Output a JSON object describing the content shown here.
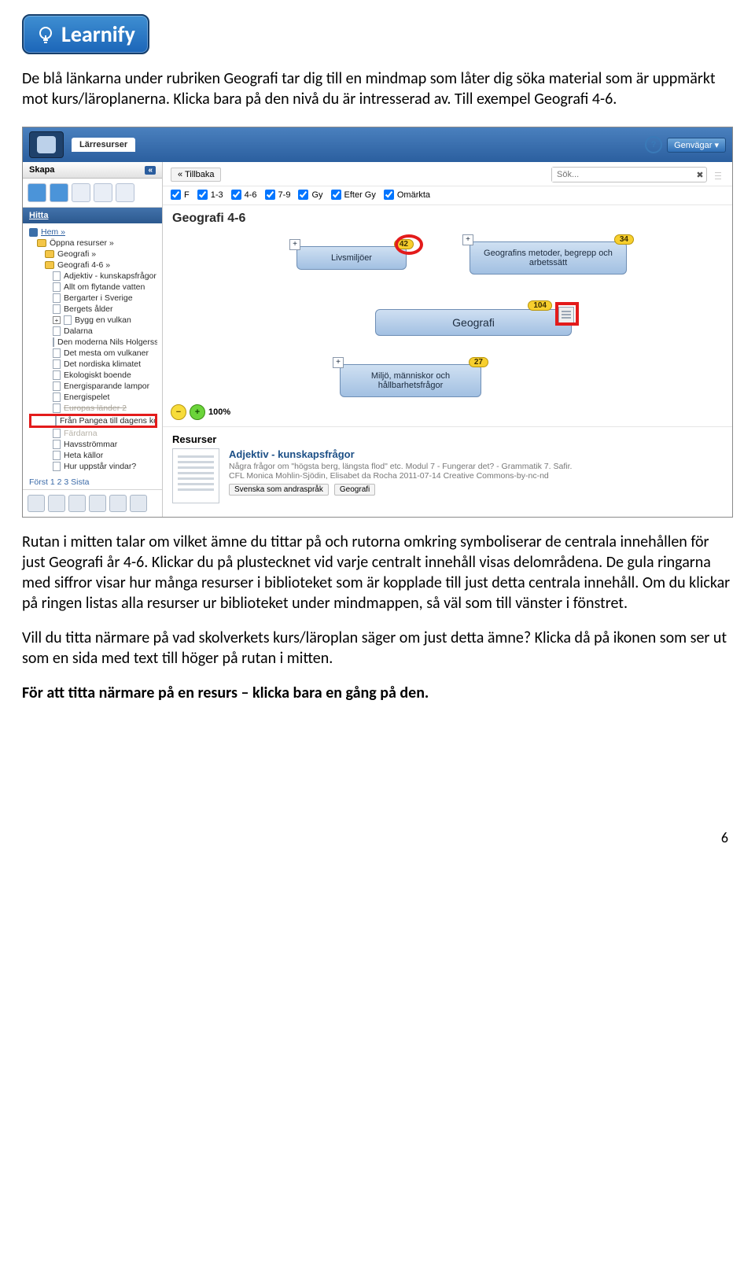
{
  "logo_text": "Learnify",
  "paragraph_1": "De blå länkarna under rubriken Geografi tar dig till en mindmap som låter dig söka material som är uppmärkt mot kurs/läroplanerna. Klicka bara på den nivå du är intresserad av. Till exempel Geografi 4-6.",
  "paragraph_2": "Rutan i mitten talar om vilket ämne du tittar på och rutorna omkring symboliserar de centrala innehållen för just Geografi år 4-6. Klickar du på plustecknet vid varje centralt innehåll visas delområdena. De gula ringarna med siffror visar hur många resurser i biblioteket som är kopplade till just detta centrala innehåll. Om du klickar på ringen listas alla resurser ur biblioteket under mindmappen, så väl som till vänster i fönstret.",
  "paragraph_3": "Vill du titta närmare på vad skolverkets kurs/läroplan säger om just detta ämne? Klicka då på ikonen som ser ut som en sida med text till höger på rutan i mitten.",
  "paragraph_4": "För att titta närmare på en resurs – klicka bara en gång på den.",
  "page_number": "6",
  "screenshot": {
    "title_tab": "Lärresurser",
    "shortcuts_btn": "Genvägar ▾",
    "sidebar": {
      "skapa": "Skapa",
      "hitta": "Hitta",
      "hem": "Hem »",
      "item_open": "Öppna resurser »",
      "item_geo": "Geografi »",
      "item_geo46": "Geografi 4-6 »",
      "items": [
        "Adjektiv - kunskapsfrågor",
        "Allt om flytande vatten",
        "Bergarter i Sverige",
        "Bergets ålder",
        "Bygg en vulkan",
        "Dalarna",
        "Den moderna Nils Holgerss",
        "Det mesta om vulkaner",
        "Det nordiska klimatet",
        "Ekologiskt boende",
        "Energisparande lampor",
        "Energispelet",
        "Europas länder 2"
      ],
      "highlight_item": "Från Pangea till dagens kon",
      "items_after": [
        "Färdarna",
        "Havsströmmar",
        "Heta källor",
        "Hur uppstår vindar?"
      ],
      "pager": "Först 1 2 3 Sista"
    },
    "main": {
      "back": "« Tillbaka",
      "search_placeholder": "Sök...",
      "filters": [
        "F",
        "1-3",
        "4-6",
        "7-9",
        "Gy",
        "Efter Gy",
        "Omärkta"
      ],
      "subject": "Geografi 4-6",
      "nodes": {
        "liv": "Livsmiljöer",
        "liv_count": "42",
        "metoder": "Geografins metoder, begrepp och arbetssätt",
        "metoder_count": "34",
        "center": "Geografi",
        "center_count": "104",
        "miljo": "Miljö, människor och hållbarhetsfrågor",
        "miljo_count": "27"
      },
      "zoom_pct": "100%",
      "resurser_head": "Resurser",
      "resource": {
        "title": "Adjektiv - kunskapsfrågor",
        "desc": "Några frågor om \"högsta berg, längsta flod\" etc. Modul 7 - Fungerar det? - Grammatik 7. Safir.",
        "meta": "CFL Monica Mohlin-Sjödin, Elisabet da Rocha 2011-07-14 Creative Commons-by-nc-nd",
        "tag1": "Svenska som andraspråk",
        "tag2": "Geografi"
      }
    }
  }
}
